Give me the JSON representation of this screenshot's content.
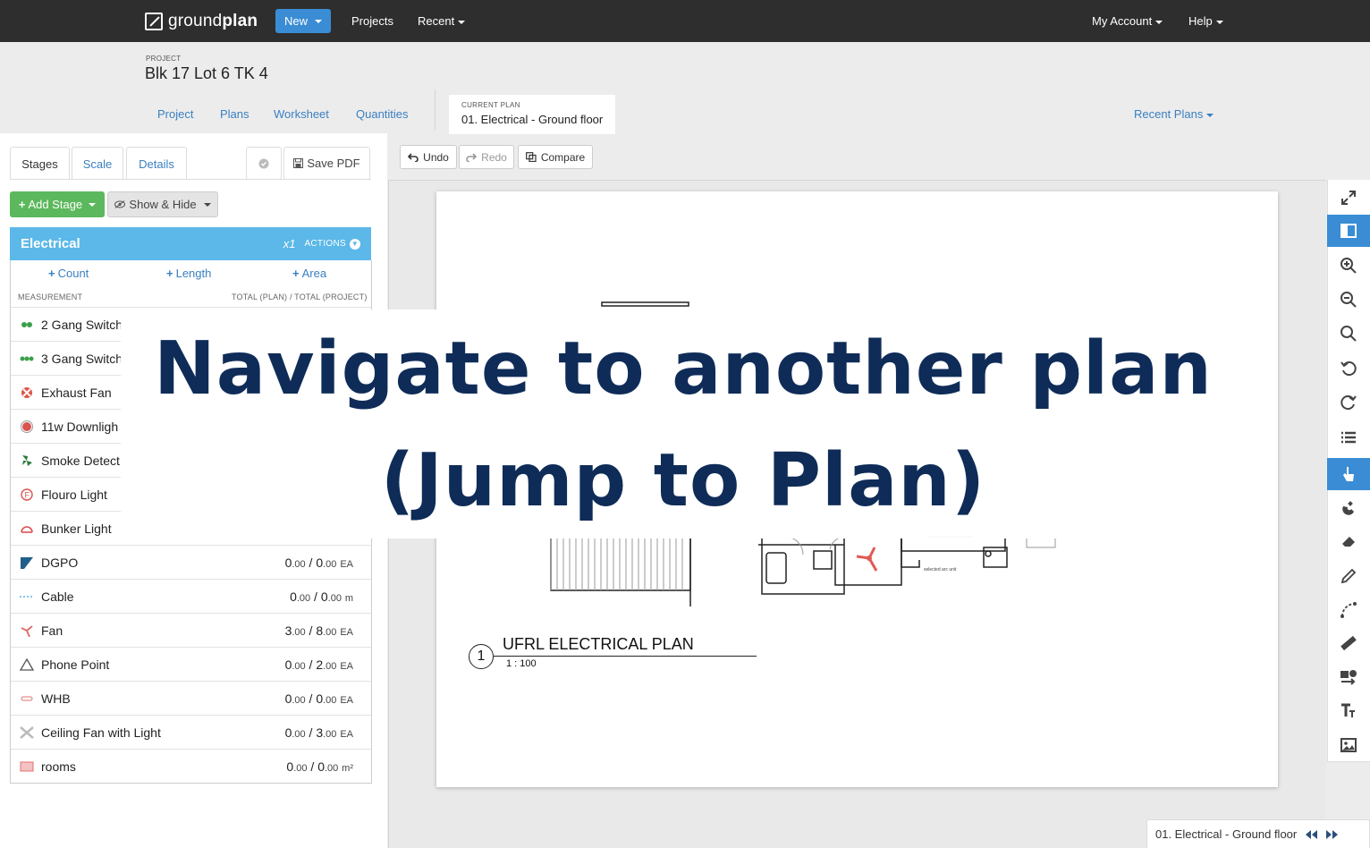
{
  "navbar": {
    "logo_light": "ground",
    "logo_bold": "plan",
    "new_label": "New",
    "projects_label": "Projects",
    "recent_label": "Recent",
    "account_label": "My Account",
    "help_label": "Help"
  },
  "project": {
    "label": "PROJECT",
    "title": "Blk 17 Lot 6 TK 4",
    "tabs": [
      "Project",
      "Plans",
      "Worksheet",
      "Quantities"
    ],
    "current_plan_label": "CURRENT PLAN",
    "current_plan": "01. Electrical - Ground floor",
    "recent_plans_label": "Recent Plans"
  },
  "left_tabs": {
    "stages": "Stages",
    "scale": "Scale",
    "details": "Details",
    "save_pdf": "Save PDF"
  },
  "stage_buttons": {
    "add_stage": "Add Stage",
    "show_hide": "Show & Hide"
  },
  "stage": {
    "name": "Electrical",
    "multiplier": "x1",
    "actions": "ACTIONS",
    "add_count": "Count",
    "add_length": "Length",
    "add_area": "Area",
    "col_measurement": "MEASUREMENT",
    "col_totals": "TOTAL (PLAN) / TOTAL (PROJECT)"
  },
  "measurements": [
    {
      "name": "2 Gang Switch",
      "icon": "double-dot-icon",
      "color": "#3aa04a"
    },
    {
      "name": "3 Gang Switch",
      "icon": "triple-dot-icon",
      "color": "#3aa04a"
    },
    {
      "name": "Exhaust Fan",
      "icon": "exhaust-fan-icon",
      "color": "#e0544a"
    },
    {
      "name": "11w Downligh",
      "icon": "downlight-icon",
      "color": "#d9534f"
    },
    {
      "name": "Smoke Detect",
      "icon": "smoke-detector-icon",
      "color": "#2a7a3a"
    },
    {
      "name": "Flouro Light",
      "icon": "flouro-icon",
      "color": "#d9534f"
    },
    {
      "name": "Bunker Light",
      "icon": "bunker-icon",
      "color": "#d9534f"
    },
    {
      "name": "DGPO",
      "icon": "dgpo-icon",
      "color": "#1f5f8a",
      "plan": "0",
      "plan_dec": ".00",
      "proj": "0",
      "proj_dec": ".00",
      "unit": "EA"
    },
    {
      "name": "Cable",
      "icon": "cable-icon",
      "color": "#5bb8e8",
      "plan": "0",
      "plan_dec": ".00",
      "proj": "0",
      "proj_dec": ".00",
      "unit": "m"
    },
    {
      "name": "Fan",
      "icon": "fan-icon",
      "color": "#e07070",
      "plan": "3",
      "plan_dec": ".00",
      "proj": "8",
      "proj_dec": ".00",
      "unit": "EA"
    },
    {
      "name": "Phone Point",
      "icon": "triangle-icon",
      "color": "#555",
      "plan": "0",
      "plan_dec": ".00",
      "proj": "2",
      "proj_dec": ".00",
      "unit": "EA"
    },
    {
      "name": "WHB",
      "icon": "whb-icon",
      "color": "#e07070",
      "plan": "0",
      "plan_dec": ".00",
      "proj": "0",
      "proj_dec": ".00",
      "unit": "EA"
    },
    {
      "name": "Ceiling Fan with Light",
      "icon": "ceiling-fan-icon",
      "color": "#bbb",
      "plan": "0",
      "plan_dec": ".00",
      "proj": "3",
      "proj_dec": ".00",
      "unit": "EA"
    },
    {
      "name": "rooms",
      "icon": "rooms-icon",
      "color": "#e07070",
      "plan": "0",
      "plan_dec": ".00",
      "proj": "0",
      "proj_dec": ".00",
      "unit": "m²"
    }
  ],
  "toolbar": {
    "undo": "Undo",
    "redo": "Redo",
    "compare": "Compare"
  },
  "plan_drawing": {
    "number": "1",
    "title": "UFRL ELECTRICAL PLAN",
    "scale": "1 : 100"
  },
  "bottom_nav": {
    "plan_name": "01. Electrical - Ground floor"
  },
  "overlay": {
    "line1": "Navigate to another plan",
    "line2": "(Jump to Plan)"
  },
  "colors": {
    "navbar": "#2e2e2e",
    "accent": "#3a8dd4",
    "stage_header": "#5bb8e8",
    "add_green": "#5cb85c",
    "overlay_text": "#0f2c58"
  }
}
